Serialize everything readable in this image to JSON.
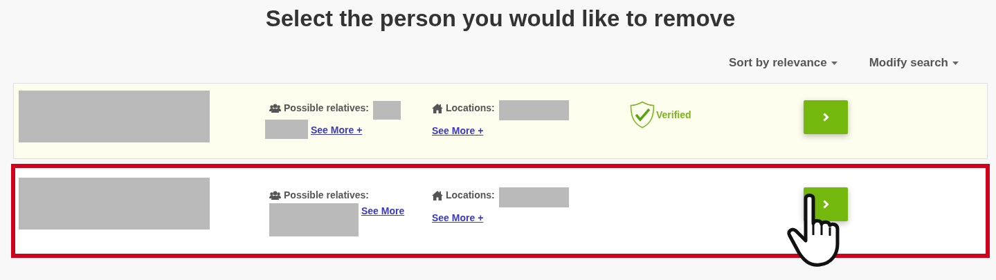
{
  "title": "Select the person you would like to remove",
  "toolbar": [
    {
      "label": "Sort by relevance"
    },
    {
      "label": "Modify search"
    }
  ],
  "records": [
    {
      "highlighted": false,
      "verified": true,
      "verified_label": "Verified",
      "relatives_label": "Possible relatives:",
      "relatives_link": "See More +",
      "locations_label": "Locations:",
      "locations_link": "See More +"
    },
    {
      "highlighted": true,
      "verified": false,
      "relatives_label": "Possible relatives:",
      "relatives_link": "See More",
      "locations_label": "Locations:",
      "locations_link": "See More +"
    }
  ]
}
